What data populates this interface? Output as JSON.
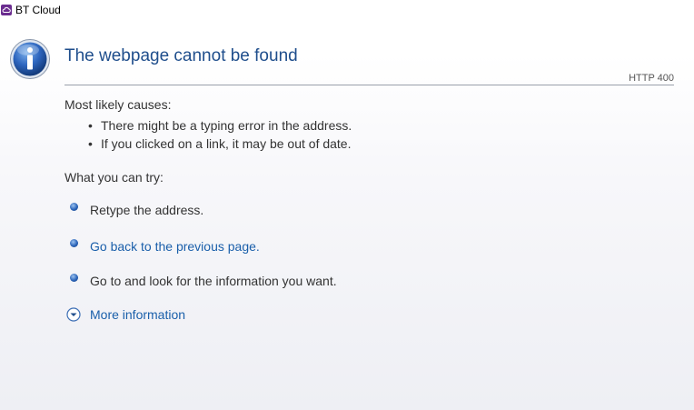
{
  "window": {
    "title": "BT Cloud"
  },
  "error": {
    "title": "The webpage cannot be found",
    "code": "HTTP 400"
  },
  "causes": {
    "heading": "Most likely causes:",
    "items": [
      "There might be a typing error in the address.",
      "If you clicked on a link, it may be out of date."
    ]
  },
  "try": {
    "heading": "What you can try:",
    "retype": "Retype the address.",
    "go_back": "Go back to the previous page.",
    "go_to": "Go to  and look for the information you want."
  },
  "more_info": "More information",
  "colors": {
    "title": "#1f4e8c",
    "link": "#1a5faa",
    "app_icon": "#6b2d8f"
  }
}
